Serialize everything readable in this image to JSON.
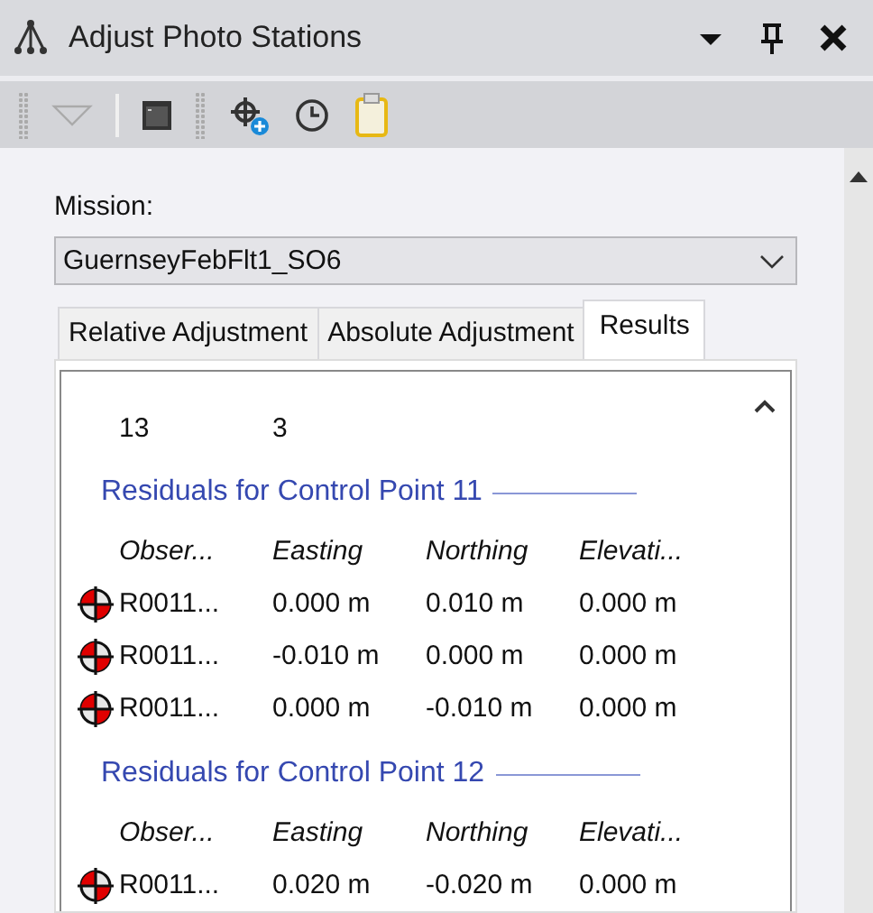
{
  "window": {
    "title": "Adjust Photo Stations"
  },
  "mission": {
    "label": "Mission:",
    "value": "GuernseyFebFlt1_SO6"
  },
  "tabs": [
    {
      "label": "Relative Adjustment",
      "selected": false
    },
    {
      "label": "Absolute Adjustment",
      "selected": false
    },
    {
      "label": "Results",
      "selected": true
    }
  ],
  "results": {
    "summary_rows": [
      [
        "13",
        "3"
      ]
    ],
    "sections": [
      {
        "title": "Residuals for Control Point 11",
        "columns": [
          "Obser...",
          "Easting",
          "Northing",
          "Elevati..."
        ],
        "rows": [
          {
            "observation": "R0011...",
            "easting": "0.000 m",
            "northing": "0.010 m",
            "elevation": "0.000 m"
          },
          {
            "observation": "R0011...",
            "easting": "-0.010 m",
            "northing": "0.000 m",
            "elevation": "0.000 m"
          },
          {
            "observation": "R0011...",
            "easting": "0.000 m",
            "northing": "-0.010 m",
            "elevation": "0.000 m"
          }
        ]
      },
      {
        "title": "Residuals for Control Point 12",
        "columns": [
          "Obser...",
          "Easting",
          "Northing",
          "Elevati..."
        ],
        "rows": [
          {
            "observation": "R0011...",
            "easting": "0.020 m",
            "northing": "-0.020 m",
            "elevation": "0.000 m"
          }
        ]
      }
    ]
  }
}
